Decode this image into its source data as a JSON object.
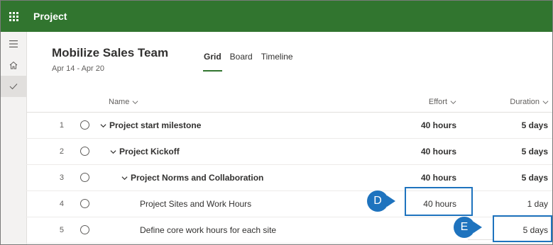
{
  "topbar": {
    "app_title": "Project"
  },
  "rail": {
    "menu_icon": "hamburger-icon",
    "home_icon": "home-icon",
    "check_icon": "checkmark-icon"
  },
  "project": {
    "title": "Mobilize Sales Team",
    "dates": "Apr 14 - Apr 20"
  },
  "tabs": [
    {
      "label": "Grid",
      "active": true
    },
    {
      "label": "Board",
      "active": false
    },
    {
      "label": "Timeline",
      "active": false
    }
  ],
  "columns": {
    "name": "Name",
    "effort": "Effort",
    "duration": "Duration"
  },
  "rows": [
    {
      "num": "1",
      "name": "Project start milestone",
      "effort": "40 hours",
      "duration": "5 days",
      "bold": true,
      "expandable": true
    },
    {
      "num": "2",
      "name": "Project Kickoff",
      "effort": "40 hours",
      "duration": "5 days",
      "bold": true,
      "expandable": true
    },
    {
      "num": "3",
      "name": "Project Norms and Collaboration",
      "effort": "40 hours",
      "duration": "5 days",
      "bold": true,
      "expandable": true
    },
    {
      "num": "4",
      "name": "Project Sites and Work Hours",
      "effort": "40 hours",
      "duration": "1 day",
      "bold": false,
      "expandable": false
    },
    {
      "num": "5",
      "name": "Define core work hours for each site",
      "effort": "",
      "duration": "5 days",
      "bold": false,
      "expandable": false
    }
  ],
  "callouts": {
    "d": "D",
    "e": "E"
  },
  "colors": {
    "brand": "#31752f",
    "callout": "#1e73be"
  }
}
